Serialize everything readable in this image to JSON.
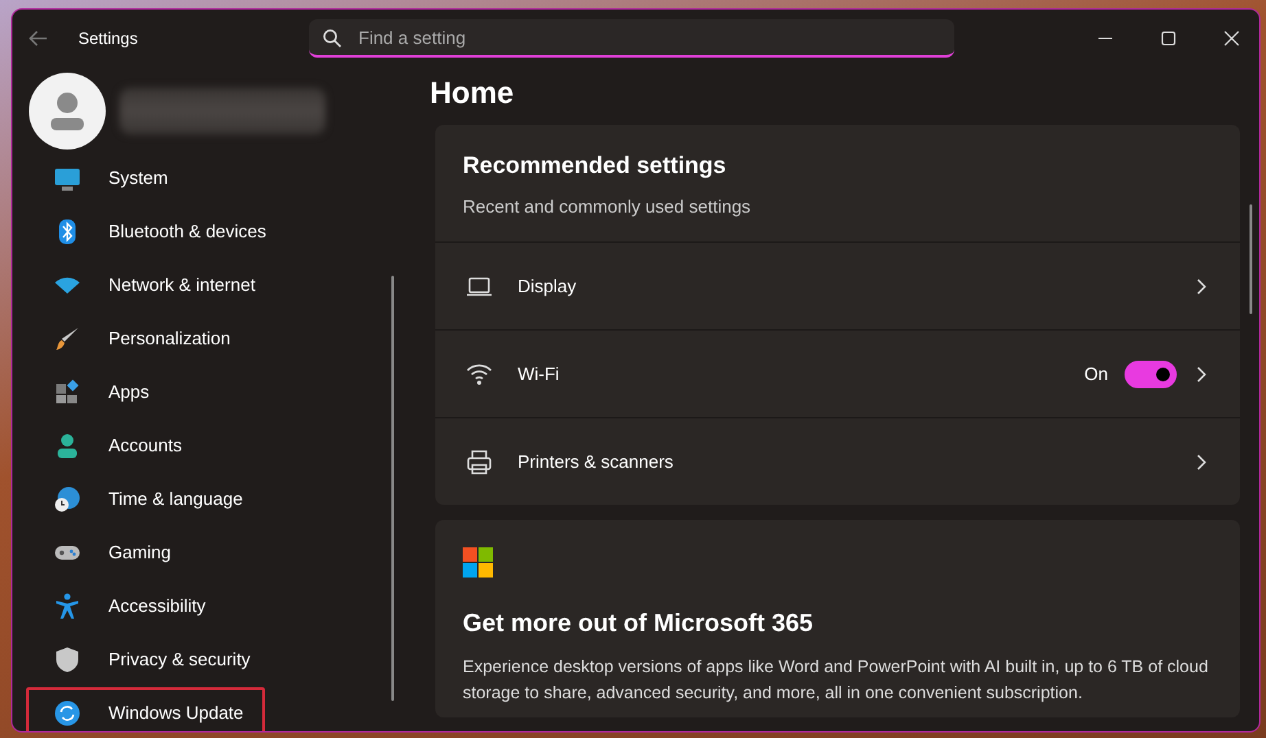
{
  "window": {
    "title": "Settings"
  },
  "search": {
    "placeholder": "Find a setting"
  },
  "sidebar": {
    "items": [
      {
        "label": "System",
        "highlighted": false
      },
      {
        "label": "Bluetooth & devices",
        "highlighted": false
      },
      {
        "label": "Network & internet",
        "highlighted": false
      },
      {
        "label": "Personalization",
        "highlighted": false
      },
      {
        "label": "Apps",
        "highlighted": false
      },
      {
        "label": "Accounts",
        "highlighted": false
      },
      {
        "label": "Time & language",
        "highlighted": false
      },
      {
        "label": "Gaming",
        "highlighted": false
      },
      {
        "label": "Accessibility",
        "highlighted": false
      },
      {
        "label": "Privacy & security",
        "highlighted": false
      },
      {
        "label": "Windows Update",
        "highlighted": true
      }
    ]
  },
  "page": {
    "title": "Home"
  },
  "recommended": {
    "title": "Recommended settings",
    "subtitle": "Recent and commonly used settings",
    "rows": [
      {
        "kind": "link",
        "label": "Display"
      },
      {
        "kind": "toggle",
        "label": "Wi-Fi",
        "status": "On",
        "on": true
      },
      {
        "kind": "link",
        "label": "Printers & scanners"
      }
    ]
  },
  "promo": {
    "title": "Get more out of Microsoft 365",
    "text": "Experience desktop versions of apps like Word and PowerPoint with AI built in, up to 6 TB of cloud storage to share, advanced security, and more, all in one convenient subscription."
  }
}
